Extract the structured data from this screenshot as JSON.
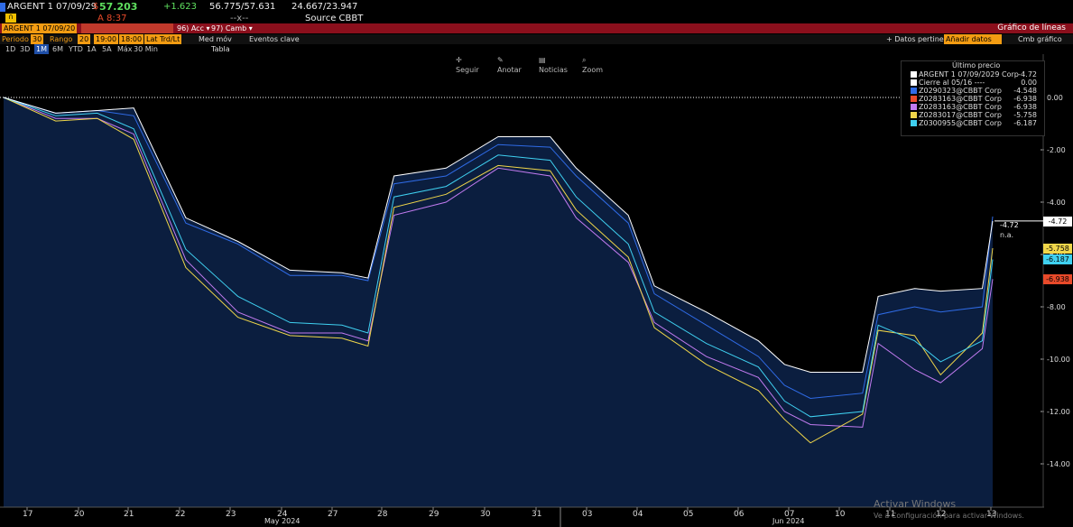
{
  "header": {
    "ticker": "ARGENT 1 07/09/29",
    "price": "57.203",
    "change": "+1.623",
    "range": "56.775/57.631",
    "yield_pair": "24.667/23.947",
    "time": "A 8:37",
    "dashes": "--x--",
    "source": "Source CBBT",
    "security_field": "ARGENT 1 07/09/20",
    "action_96": "96) Acc",
    "action_97": "97) Camb",
    "chart_title": "Gráfico de líneas"
  },
  "toolbar": {
    "period_label": "Periodo",
    "period_value": "30",
    "range_label": "Rango",
    "range_start": "20",
    "range_time1": "19:00",
    "range_time2": "18:00",
    "last_trd": "Lat Trd/Lt",
    "med_mov": "Med móv",
    "eventos": "Eventos clave",
    "datos_pertinent": "+ Datos pertinent",
    "add_datos": "Añadir datos",
    "cmb_grafico": "Cmb gráfico"
  },
  "timeframes": [
    "1D",
    "3D",
    "1M",
    "6M",
    "YTD",
    "1A",
    "5A",
    "Máx",
    "30 Min"
  ],
  "tabla_label": "Tabla",
  "chart_tools": {
    "seguir": "Seguir",
    "anotar": "Anotar",
    "noticias": "Noticias",
    "zoom": "Zoom"
  },
  "legend": {
    "title": "Último precio",
    "rows": [
      {
        "label": "ARGENT 1 07/09/2029 Corp",
        "value": "-4.72",
        "color": "#ffffff"
      },
      {
        "label": "Cierre al 05/16 ----",
        "value": "0.00",
        "color": "#ffffff"
      },
      {
        "label": "Z0290323@CBBT Corp",
        "value": "-4.548",
        "color": "#2f6be6"
      },
      {
        "label": "Z0283163@CBBT Corp",
        "value": "-6.938",
        "color": "#e84a2a"
      },
      {
        "label": "Z0283163@CBBT Corp",
        "value": "-6.938",
        "color": "#c27bf0"
      },
      {
        "label": "Z0283017@CBBT Corp",
        "value": "-5.758",
        "color": "#f0d64a"
      },
      {
        "label": "Z0300955@CBBT Corp",
        "value": "-6.187",
        "color": "#3fd0f0"
      }
    ]
  },
  "last_callout": {
    "value": "-4.72",
    "sub": "n.a."
  },
  "right_caps": [
    {
      "text": "-4.72",
      "bg": "#ffffff",
      "fg": "#000000",
      "y": -4.72
    },
    {
      "text": "-5.758",
      "bg": "#f0d64a",
      "fg": "#000000",
      "y": -5.758
    },
    {
      "text": "-6.187",
      "bg": "#3fd0f0",
      "fg": "#000000",
      "y": -6.187
    },
    {
      "text": "-6.938",
      "bg": "#e84a2a",
      "fg": "#000000",
      "y": -6.938
    }
  ],
  "watermark": {
    "line1": "Activar Windows",
    "line2": "Ve a Configuración para activar Windows."
  },
  "chart_data": {
    "type": "line",
    "x_ticks": [
      "17",
      "20",
      "21",
      "22",
      "23",
      "24",
      "27",
      "28",
      "29",
      "30",
      "31",
      "03",
      "04",
      "05",
      "06",
      "07",
      "10",
      "11",
      "12",
      "13"
    ],
    "month_labels": [
      "May 2024",
      "Jun 2024"
    ],
    "y_ticks": [
      "0.00",
      "-2.00",
      "-4.00",
      "-6.00",
      "-8.00",
      "-10.00",
      "-12.00",
      "-14.00"
    ],
    "ylim": [
      -15.5,
      0.6
    ],
    "xlim": [
      0,
      19.6
    ],
    "series": [
      {
        "name": "ARGENT 1 07/09/2029 Corp",
        "color": "#ffffff",
        "values": [
          0.0,
          -0.6,
          -0.5,
          -0.4,
          -4.6,
          -5.5,
          -6.6,
          -6.7,
          -6.9,
          -3.0,
          -2.7,
          -1.5,
          -1.5,
          -2.7,
          -4.5,
          -7.2,
          -8.2,
          -9.3,
          -10.2,
          -10.5,
          -10.5,
          -7.6,
          -7.3,
          -7.4,
          -7.3,
          -4.72
        ]
      },
      {
        "name": "Z0290323@CBBT Corp",
        "color": "#2f6be6",
        "values": [
          0.0,
          -0.6,
          -0.5,
          -0.7,
          -4.8,
          -5.6,
          -6.8,
          -6.8,
          -7.0,
          -3.3,
          -3.0,
          -1.8,
          -1.9,
          -3.0,
          -4.8,
          -7.5,
          -8.7,
          -9.9,
          -11.0,
          -11.5,
          -11.3,
          -8.3,
          -8.0,
          -8.2,
          -8.0,
          -4.55
        ]
      },
      {
        "name": "Z0283163@CBBT Corp",
        "color": "#c27bf0",
        "values": [
          0.0,
          -0.8,
          -0.8,
          -1.4,
          -6.2,
          -8.2,
          -9.0,
          -9.0,
          -9.3,
          -4.5,
          -4.0,
          -2.7,
          -3.0,
          -4.6,
          -6.3,
          -8.6,
          -9.9,
          -10.7,
          -12.0,
          -12.5,
          -12.6,
          -9.4,
          -10.4,
          -10.9,
          -9.6,
          -6.94
        ]
      },
      {
        "name": "Z0283017@CBBT Corp",
        "color": "#f0d64a",
        "values": [
          0.0,
          -0.9,
          -0.8,
          -1.6,
          -6.5,
          -8.4,
          -9.1,
          -9.2,
          -9.5,
          -4.2,
          -3.7,
          -2.6,
          -2.8,
          -4.3,
          -6.1,
          -8.8,
          -10.2,
          -11.2,
          -12.3,
          -13.2,
          -12.1,
          -8.9,
          -9.1,
          -10.6,
          -9.0,
          -5.76
        ]
      },
      {
        "name": "Z0300955@CBBT Corp",
        "color": "#3fd0f0",
        "values": [
          0.0,
          -0.7,
          -0.6,
          -1.2,
          -5.8,
          -7.6,
          -8.6,
          -8.7,
          -9.0,
          -3.8,
          -3.4,
          -2.2,
          -2.4,
          -3.8,
          -5.6,
          -8.2,
          -9.4,
          -10.3,
          -11.6,
          -12.2,
          -12.0,
          -8.7,
          -9.3,
          -10.1,
          -9.3,
          -6.19
        ]
      }
    ],
    "x_positions": [
      0,
      1,
      1.8,
      2.5,
      3.5,
      4.5,
      5.5,
      6.5,
      7,
      7.5,
      8.5,
      9.5,
      10.5,
      11,
      12,
      12.5,
      13.5,
      14.5,
      15,
      15.5,
      16.5,
      16.8,
      17.5,
      18,
      18.8,
      19
    ]
  }
}
